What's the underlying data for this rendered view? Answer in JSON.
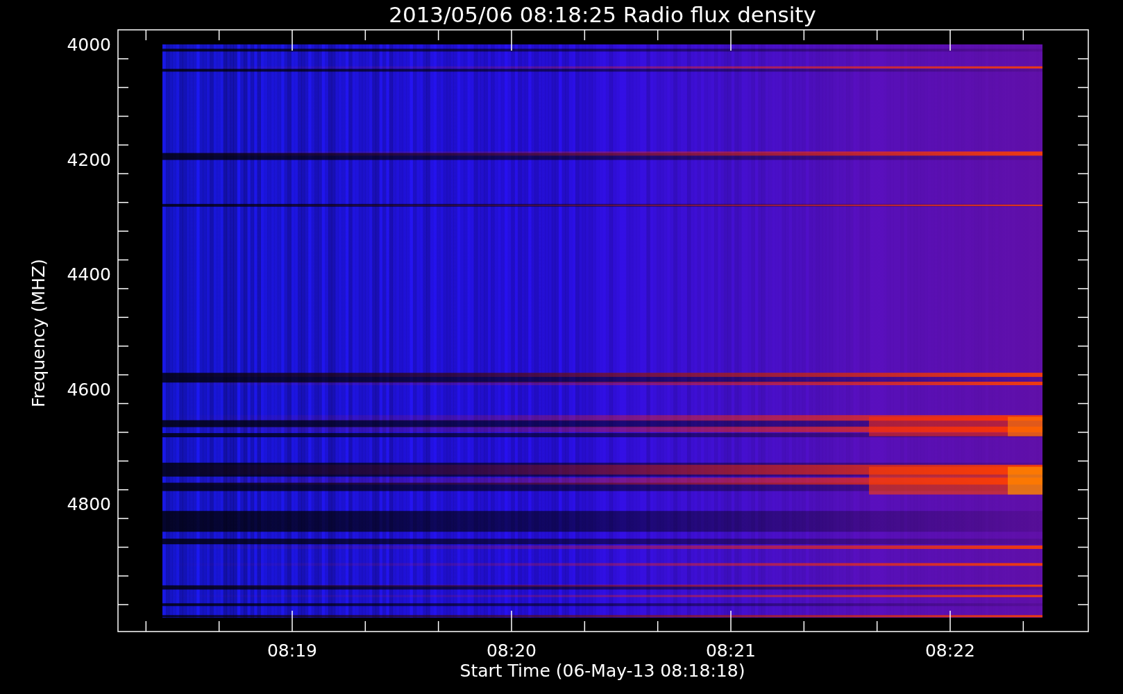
{
  "title": "2013/05/06 08:18:25 Radio flux density",
  "y_axis": {
    "label": "Frequency (MHZ)",
    "ticks": [
      "4000",
      "4200",
      "4400",
      "4600",
      "4800"
    ]
  },
  "x_axis": {
    "label": "Start Time (06-May-13 08:18:18)",
    "ticks": [
      "08:19",
      "08:20",
      "08:21",
      "08:22"
    ]
  }
}
